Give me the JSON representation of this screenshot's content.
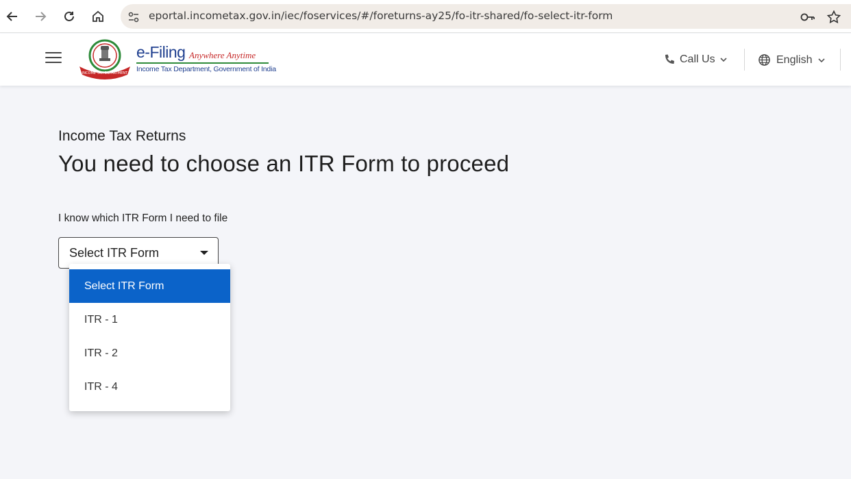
{
  "browser": {
    "url": "eportal.incometax.gov.in/iec/foservices/#/foreturns-ay25/fo-itr-shared/fo-select-itr-form"
  },
  "header": {
    "brand_title": "e-Filing",
    "brand_tagline": "Anywhere Anytime",
    "brand_sub": "Income Tax Department, Government of India",
    "emblem_text": "INCOME TAX DEPARTMENT",
    "call_us_label": "Call Us",
    "language_label": "English"
  },
  "main": {
    "breadcrumb": "Income Tax Returns",
    "title": "You need to choose an ITR Form to proceed",
    "field_label": "I know which ITR Form I need to file",
    "select_value": "Select ITR Form",
    "options": [
      {
        "label": "Select ITR Form"
      },
      {
        "label": "ITR - 1"
      },
      {
        "label": "ITR - 2"
      },
      {
        "label": "ITR - 4"
      }
    ]
  },
  "colors": {
    "accent": "#0b63c9",
    "brand_blue": "#1f3f8f",
    "brand_red": "#c62828",
    "brand_green": "#2e8b3a"
  }
}
